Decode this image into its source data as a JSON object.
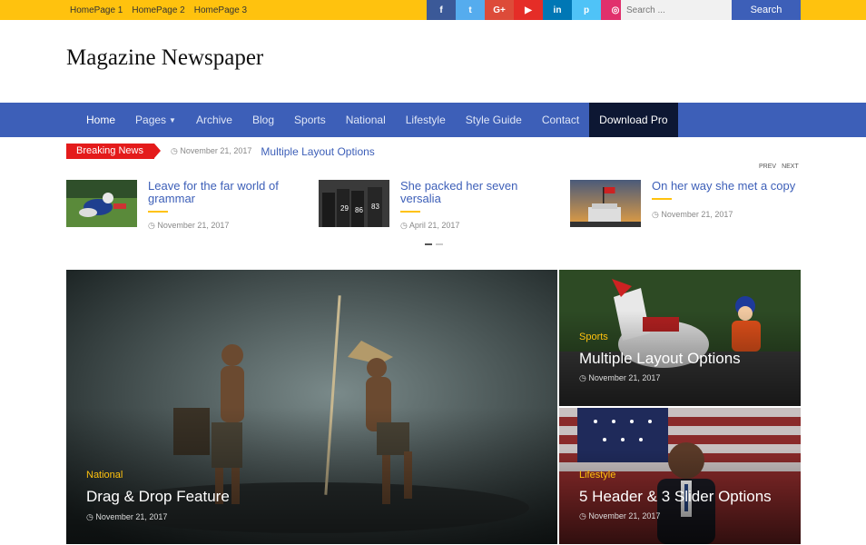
{
  "topbar": {
    "links": [
      "HomePage 1",
      "HomePage 2",
      "HomePage 3"
    ],
    "social": [
      {
        "icon": "facebook-icon",
        "glyph": "f",
        "color": "#3b5998"
      },
      {
        "icon": "twitter-icon",
        "glyph": "t",
        "color": "#55acee"
      },
      {
        "icon": "google-plus-icon",
        "glyph": "G+",
        "color": "#dd4b39"
      },
      {
        "icon": "youtube-icon",
        "glyph": "▶",
        "color": "#e52d27"
      },
      {
        "icon": "linkedin-icon",
        "glyph": "in",
        "color": "#0077b5"
      },
      {
        "icon": "pinterest-icon",
        "glyph": "p",
        "color": "#4fc3f7"
      },
      {
        "icon": "instagram-icon",
        "glyph": "◎",
        "color": "#e1306c"
      }
    ],
    "search_placeholder": "Search ...",
    "search_label": "Search"
  },
  "header": {
    "title": "Magazine Newspaper"
  },
  "nav": {
    "items": [
      "Home",
      "Pages",
      "Archive",
      "Blog",
      "Sports",
      "National",
      "Lifestyle",
      "Style Guide",
      "Contact"
    ],
    "pro": "Download Pro"
  },
  "breaking": {
    "label": "Breaking News",
    "date": "November 21, 2017",
    "title": "Multiple Layout Options"
  },
  "pager": {
    "prev": "PREV",
    "next": "NEXT"
  },
  "posts": [
    {
      "title": "Leave for the far world of grammar",
      "date": "November 21, 2017"
    },
    {
      "title": "She packed her seven versalia",
      "date": "April 21, 2017"
    },
    {
      "title": "On her way she met a copy",
      "date": "November 21, 2017"
    }
  ],
  "features": [
    {
      "category": "National",
      "title": "Drag & Drop Feature",
      "date": "November 21, 2017"
    },
    {
      "category": "Sports",
      "title": "Multiple Layout Options",
      "date": "November 21, 2017"
    },
    {
      "category": "Lifestyle",
      "title": "5 Header & 3 Slider Options",
      "date": "November 21, 2017"
    }
  ],
  "colors": {
    "accent": "#3d5fb8",
    "yellow": "#ffc20e",
    "breaking": "#e41b1b"
  }
}
